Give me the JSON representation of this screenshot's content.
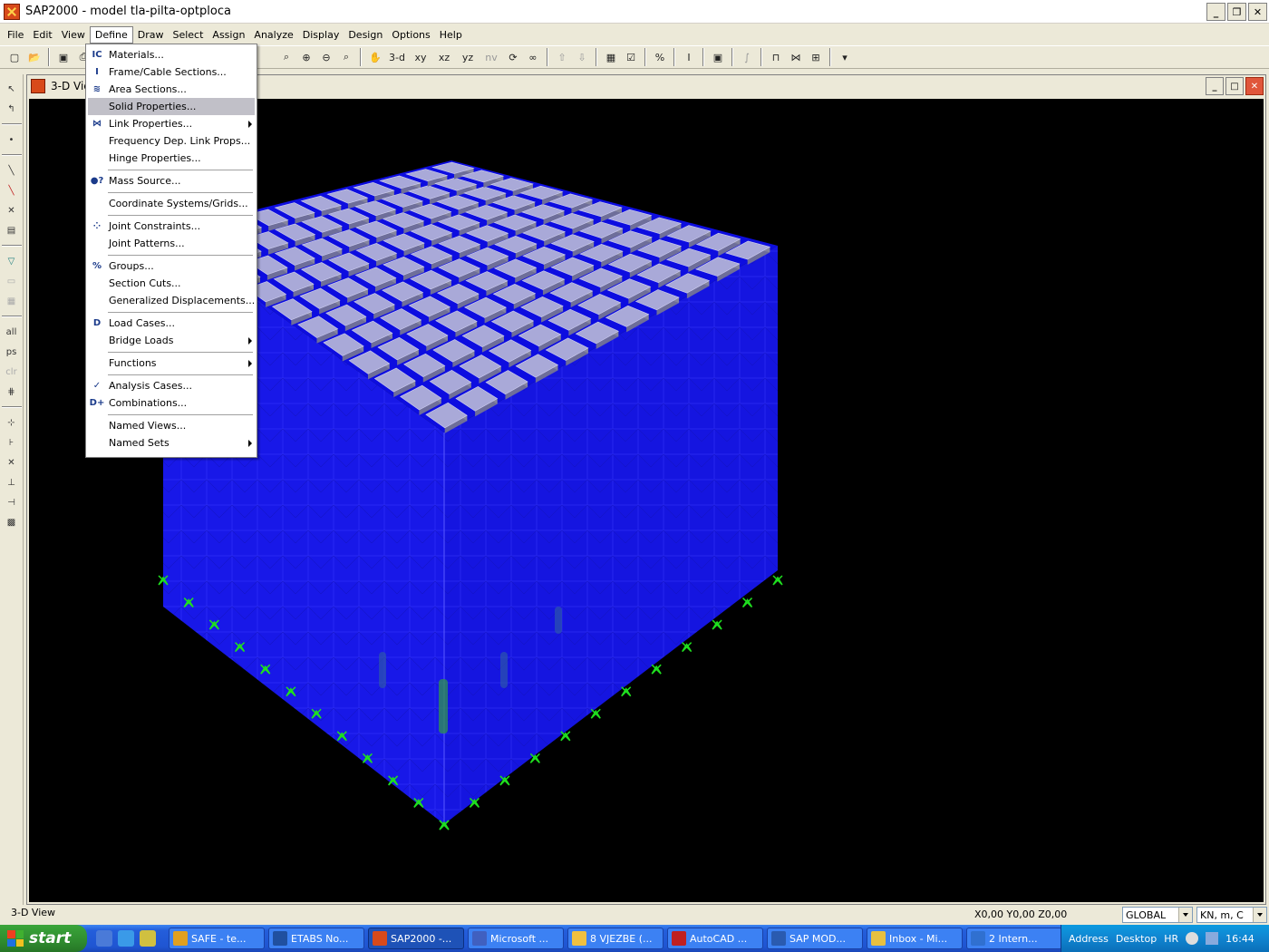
{
  "window": {
    "title": "SAP2000 - model tla-pilta-optploca"
  },
  "menubar": [
    "File",
    "Edit",
    "View",
    "Define",
    "Draw",
    "Select",
    "Assign",
    "Analyze",
    "Display",
    "Design",
    "Options",
    "Help"
  ],
  "active_menu": "Define",
  "toolbar": {
    "btn_3d": "3-d",
    "btn_xy": "xy",
    "btn_xz": "xz",
    "btn_yz": "yz",
    "btn_nv": "nv"
  },
  "child_window": {
    "title": "3-D View"
  },
  "define_menu": {
    "items": [
      {
        "label": "Materials...",
        "icon": "materials-icon"
      },
      {
        "label": "Frame/Cable Sections...",
        "icon": "frame-section-icon"
      },
      {
        "label": "Area Sections...",
        "icon": "area-section-icon"
      },
      {
        "label": "Solid Properties...",
        "highlighted": true
      },
      {
        "label": "Link Properties...",
        "icon": "link-icon",
        "submenu": true
      },
      {
        "label": "Frequency Dep. Link Props..."
      },
      {
        "label": "Hinge Properties..."
      },
      {
        "separator": true
      },
      {
        "label": "Mass  Source...",
        "icon": "mass-source-icon"
      },
      {
        "separator": true
      },
      {
        "label": "Coordinate Systems/Grids..."
      },
      {
        "separator": true
      },
      {
        "label": "Joint Constraints...",
        "icon": "joint-constraints-icon"
      },
      {
        "label": "Joint Patterns..."
      },
      {
        "separator": true
      },
      {
        "label": "Groups...",
        "icon": "groups-icon"
      },
      {
        "label": "Section Cuts..."
      },
      {
        "label": "Generalized Displacements..."
      },
      {
        "separator": true
      },
      {
        "label": "Load Cases...",
        "icon": "load-cases-icon"
      },
      {
        "label": "Bridge Loads",
        "submenu": true
      },
      {
        "separator": true
      },
      {
        "label": "Functions",
        "submenu": true
      },
      {
        "separator": true
      },
      {
        "label": "Analysis Cases...",
        "icon": "analysis-cases-icon"
      },
      {
        "label": "Combinations...",
        "icon": "combinations-icon"
      },
      {
        "separator": true
      },
      {
        "label": "Named Views..."
      },
      {
        "label": "Named Sets",
        "submenu": true
      }
    ]
  },
  "status": {
    "view_label": "3-D View",
    "coords": "X0,00  Y0,00  Z0,00",
    "coord_system": "GLOBAL",
    "units": "KN, m, C"
  },
  "taskbar": {
    "start": "start",
    "tasks": [
      {
        "label": "SAFE - te...",
        "color": "#e0a020"
      },
      {
        "label": "ETABS No...",
        "color": "#2050a0"
      },
      {
        "label": "SAP2000 -...",
        "color": "#d84a1a",
        "active": true
      },
      {
        "label": "Microsoft ...",
        "color": "#4060c0"
      },
      {
        "label": "8 VJEZBE (...",
        "color": "#f0c040"
      },
      {
        "label": "AutoCAD ...",
        "color": "#c02020"
      },
      {
        "label": "SAP  MOD...",
        "color": "#2a5bb0"
      },
      {
        "label": "Inbox - Mi...",
        "color": "#e8c040"
      },
      {
        "label": "2 Intern...",
        "color": "#3070d0"
      }
    ],
    "tray": {
      "address": "Address",
      "desktop": "Desktop",
      "lang": "HR",
      "time": "16:44"
    }
  },
  "colors": {
    "model_blue": "#1a1ae6",
    "pad_gray": "#a9a9d8",
    "support_green": "#1fe01f",
    "canvas_bg": "#000000"
  }
}
